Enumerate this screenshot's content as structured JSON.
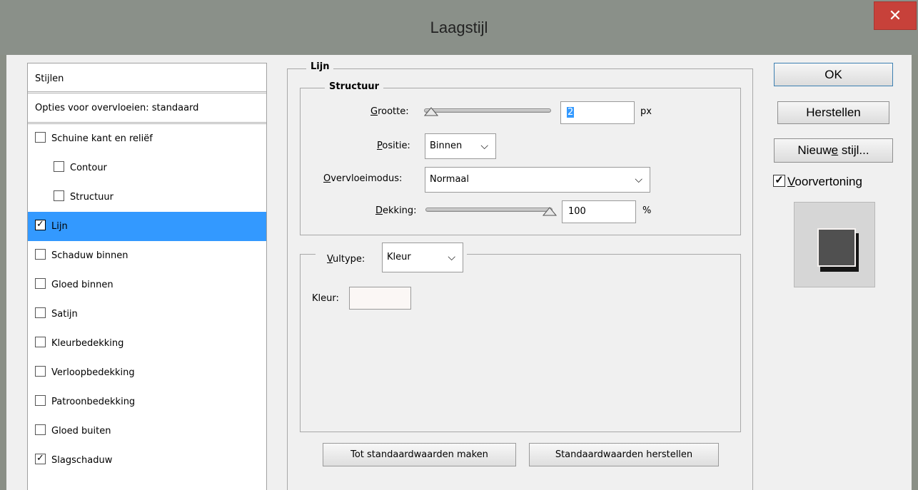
{
  "window": {
    "title": "Laagstijl",
    "close_label": "✕"
  },
  "styles_panel": {
    "header": "Stijlen",
    "blend_options": "Opties voor overvloeien: standaard",
    "items": [
      {
        "label": "Schuine kant en reliëf",
        "checked": false,
        "sub": false
      },
      {
        "label": "Contour",
        "checked": false,
        "sub": true
      },
      {
        "label": "Structuur",
        "checked": false,
        "sub": true
      },
      {
        "label": "Lijn",
        "checked": true,
        "sub": false,
        "selected": true
      },
      {
        "label": "Schaduw binnen",
        "checked": false,
        "sub": false
      },
      {
        "label": "Gloed binnen",
        "checked": false,
        "sub": false
      },
      {
        "label": "Satijn",
        "checked": false,
        "sub": false
      },
      {
        "label": "Kleurbedekking",
        "checked": false,
        "sub": false
      },
      {
        "label": "Verloopbedekking",
        "checked": false,
        "sub": false
      },
      {
        "label": "Patroonbedekking",
        "checked": false,
        "sub": false
      },
      {
        "label": "Gloed buiten",
        "checked": false,
        "sub": false
      },
      {
        "label": "Slagschaduw",
        "checked": true,
        "sub": false
      }
    ]
  },
  "lijn": {
    "title": "Lijn",
    "structure_title": "Structuur",
    "size": {
      "label_u": "G",
      "label_rest": "rootte:",
      "value": "2",
      "unit": "px",
      "slider_level": 0.02
    },
    "position": {
      "label_u": "P",
      "label_rest": "ositie:",
      "value": "Binnen"
    },
    "blend_mode": {
      "label_u": "O",
      "label_rest": "vervloeimodus:",
      "value": "Normaal"
    },
    "opacity": {
      "label_u": "D",
      "label_rest": "ekking:",
      "value": "100",
      "unit": "%",
      "slider_level": 1.0
    },
    "fill_type": {
      "label_u": "V",
      "label_rest": "ultype:",
      "value": "Kleur"
    },
    "color": {
      "label": "Kleur:",
      "swatch": "#fbf7f5"
    },
    "make_default_label": "Tot standaardwaarden maken",
    "reset_default_label": "Standaardwaarden herstellen"
  },
  "right": {
    "ok_label": "OK",
    "reset_label": "Herstellen",
    "new_style_pre": "Nieuw",
    "new_style_u": "e",
    "new_style_post": " stijl...",
    "preview_u": "V",
    "preview_rest": "oorvertoning",
    "preview_checked": true,
    "preview_swatch_color": "#505050"
  },
  "colors": {
    "selection": "#3399ff",
    "close": "#c7413a",
    "title_bar": "#8a9089"
  }
}
